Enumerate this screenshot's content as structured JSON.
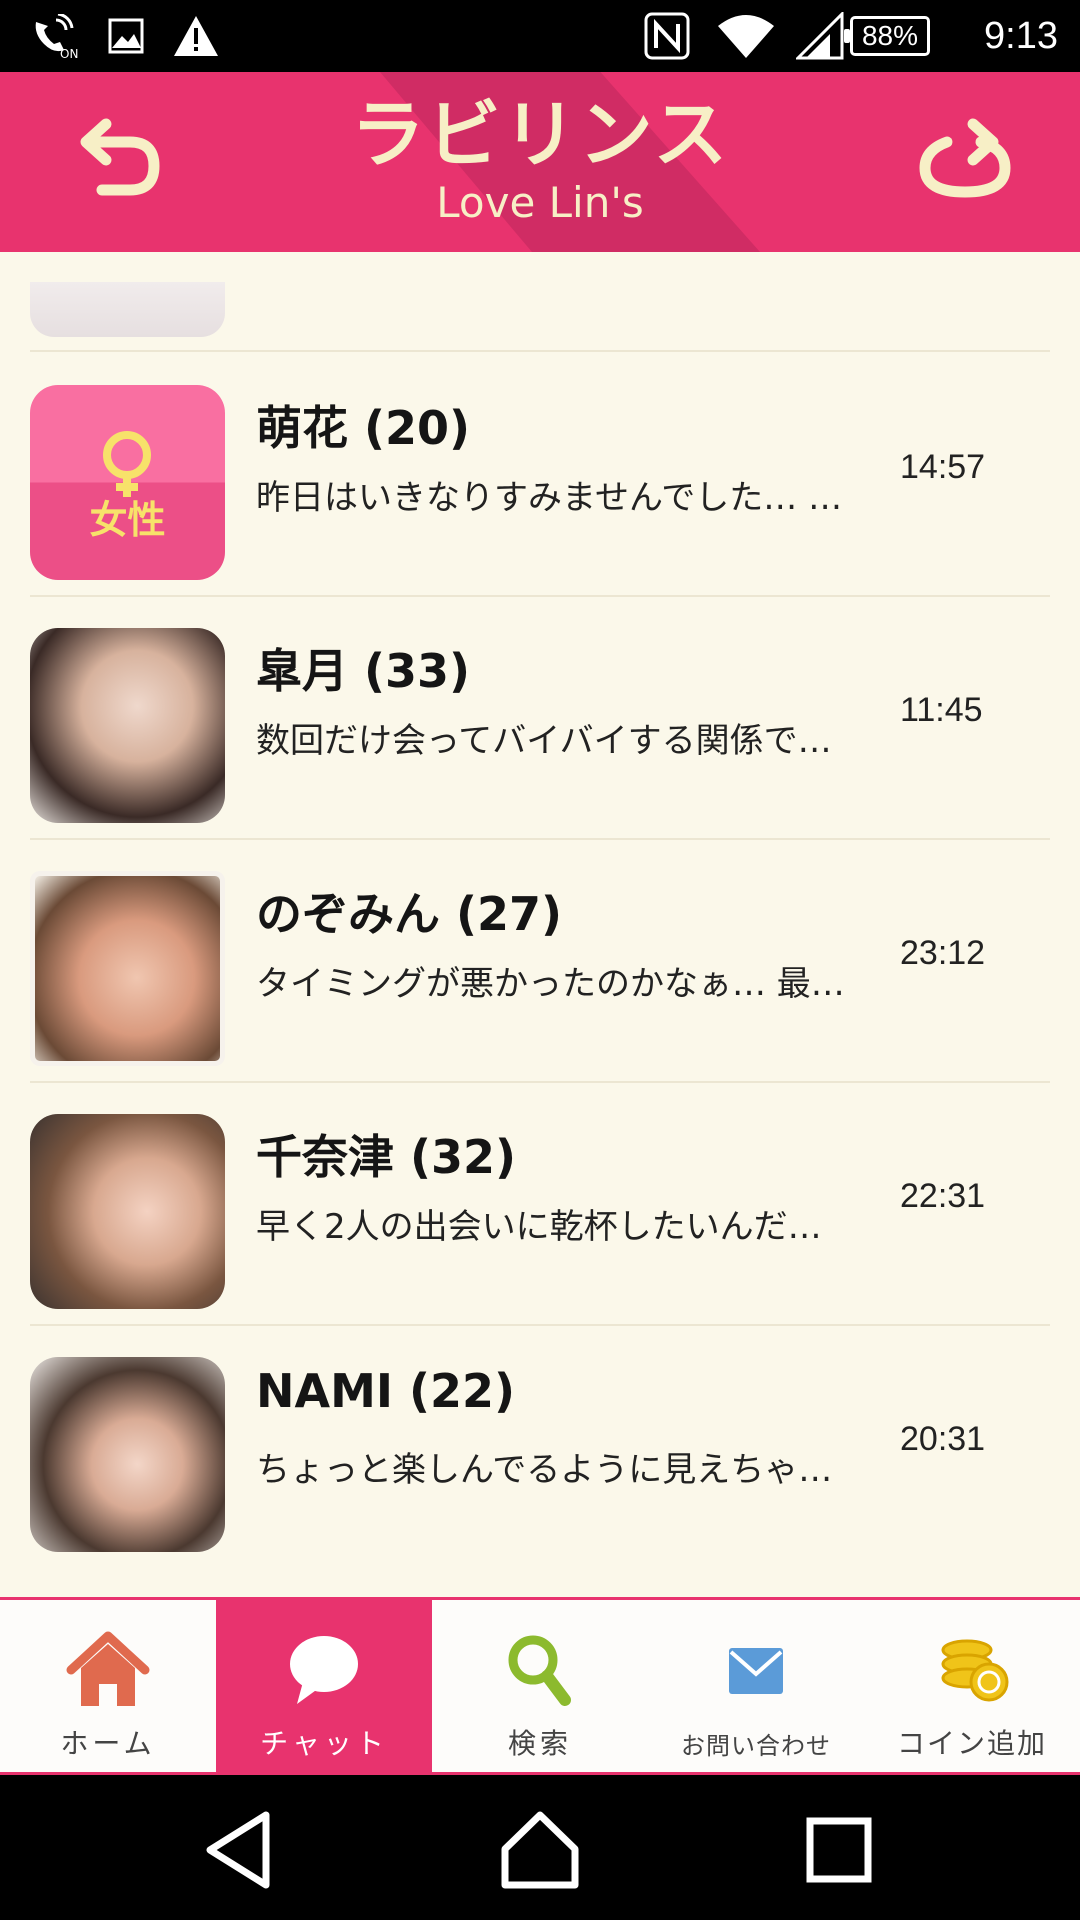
{
  "status_bar": {
    "time": "9:13",
    "battery": "88%",
    "icons": [
      "call-on-icon",
      "image-icon",
      "warning-icon",
      "nfc-icon",
      "wifi-icon",
      "signal-icon"
    ]
  },
  "header": {
    "logo_jp": "ラビリンス",
    "logo_en": "Love Lin's",
    "back_icon": "back-arrow-icon",
    "refresh_icon": "refresh-icon"
  },
  "chats": [
    {
      "name": "萌花 (20)",
      "preview": "昨日はいきなりすみませんでした… …",
      "time": "14:57",
      "avatar": "female-placeholder",
      "avatar_label": "女性"
    },
    {
      "name": "皐月 (33)",
      "preview": "数回だけ会ってバイバイする関係で…",
      "time": "11:45",
      "avatar": "photo"
    },
    {
      "name": "のぞみん (27)",
      "preview": "タイミングが悪かったのかなぁ… 最…",
      "time": "23:12",
      "avatar": "photo"
    },
    {
      "name": "千奈津 (32)",
      "preview": "早く2人の出会いに乾杯したいんだ…",
      "time": "22:31",
      "avatar": "photo"
    },
    {
      "name": "NAMI (22)",
      "preview": "ちょっと楽しんでるように見えちゃ…",
      "time": "20:31",
      "avatar": "photo"
    }
  ],
  "tabs": [
    {
      "label": "ホーム",
      "icon": "home-icon",
      "active": false
    },
    {
      "label": "チャット",
      "icon": "chat-bubble-icon",
      "active": true
    },
    {
      "label": "検索",
      "icon": "search-icon",
      "active": false
    },
    {
      "label": "お問い合わせ",
      "icon": "mail-icon",
      "active": false
    },
    {
      "label": "コイン追加",
      "icon": "coins-icon",
      "active": false
    }
  ],
  "colors": {
    "accent": "#e8336e",
    "background": "#fbf8ea",
    "logo_text": "#f7efc6"
  }
}
